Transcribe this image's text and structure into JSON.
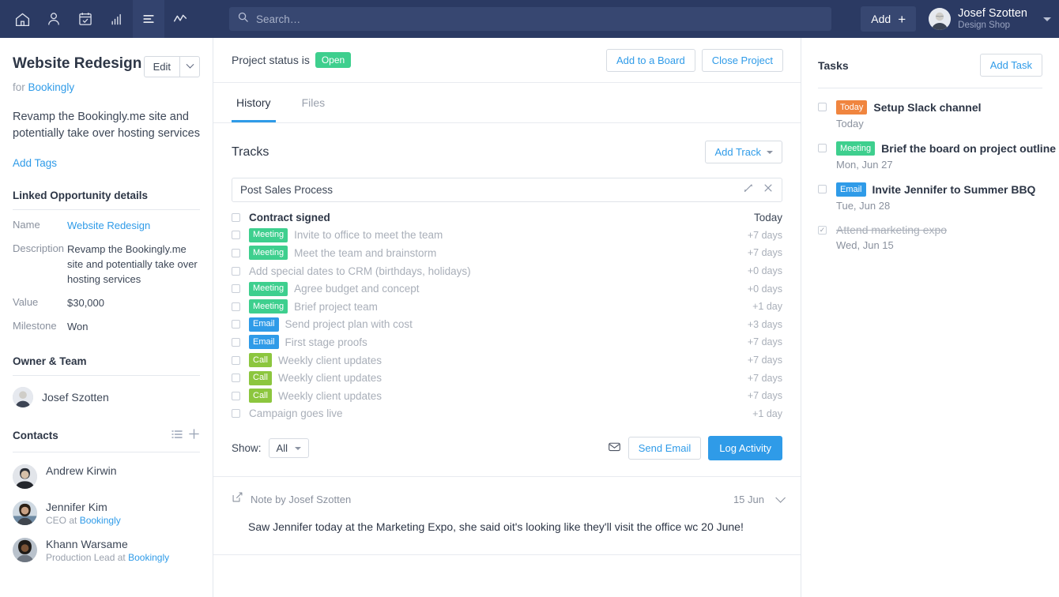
{
  "topnav": {
    "icons": [
      {
        "name": "home-icon",
        "active": false
      },
      {
        "name": "person-icon",
        "active": false
      },
      {
        "name": "calendar-icon",
        "active": false
      },
      {
        "name": "bars-chart-icon",
        "active": false
      },
      {
        "name": "list-lines-icon",
        "active": true
      },
      {
        "name": "activity-line-icon",
        "active": false
      }
    ],
    "search_placeholder": "Search…",
    "add_label": "Add",
    "user_name": "Josef Szotten",
    "user_org": "Design Shop"
  },
  "left": {
    "project_title": "Website Redesign",
    "for_label": "for",
    "company": "Bookingly",
    "edit_label": "Edit",
    "description": "Revamp the Bookingly.me site and potentially take over hosting services",
    "add_tags_label": "Add Tags",
    "opportunity_heading": "Linked Opportunity details",
    "fields": [
      {
        "key": "Name",
        "value": "Website Redesign",
        "link": true
      },
      {
        "key": "Description",
        "value": "Revamp the Bookingly.me site and potentially take over hosting services",
        "link": false
      },
      {
        "key": "Value",
        "value": "$30,000",
        "link": false
      },
      {
        "key": "Milestone",
        "value": "Won",
        "link": false
      }
    ],
    "owner_heading": "Owner & Team",
    "owner_name": "Josef Szotten",
    "contacts_heading": "Contacts",
    "contacts": [
      {
        "name": "Andrew Kirwin",
        "role": "",
        "company": ""
      },
      {
        "name": "Jennifer Kim",
        "role": "CEO at",
        "company": "Bookingly"
      },
      {
        "name": "Khann Warsame",
        "role": "Production Lead at",
        "company": "Bookingly"
      }
    ]
  },
  "center": {
    "status_prefix": "Project status is",
    "status_value": "Open",
    "add_to_board_label": "Add to a Board",
    "close_project_label": "Close Project",
    "tabs": [
      {
        "label": "History",
        "active": true
      },
      {
        "label": "Files",
        "active": false
      }
    ],
    "tracks_title": "Tracks",
    "add_track_label": "Add Track",
    "track_name": "Post Sales Process",
    "track_items": [
      {
        "tag": "",
        "tag_type": "",
        "label": "Contract signed",
        "when": "Today",
        "first": true
      },
      {
        "tag": "Meeting",
        "tag_type": "meeting",
        "label": "Invite to office to meet the team",
        "when": "+7 days",
        "first": false
      },
      {
        "tag": "Meeting",
        "tag_type": "meeting",
        "label": "Meet the team and brainstorm",
        "when": "+7 days",
        "first": false
      },
      {
        "tag": "",
        "tag_type": "",
        "label": "Add special dates to CRM (birthdays, holidays)",
        "when": "+0 days",
        "first": false
      },
      {
        "tag": "Meeting",
        "tag_type": "meeting",
        "label": "Agree budget and concept",
        "when": "+0 days",
        "first": false
      },
      {
        "tag": "Meeting",
        "tag_type": "meeting",
        "label": "Brief project team",
        "when": "+1 day",
        "first": false
      },
      {
        "tag": "Email",
        "tag_type": "email",
        "label": "Send project plan with cost",
        "when": "+3 days",
        "first": false
      },
      {
        "tag": "Email",
        "tag_type": "email",
        "label": "First stage proofs",
        "when": "+7 days",
        "first": false
      },
      {
        "tag": "Call",
        "tag_type": "call",
        "label": "Weekly client updates",
        "when": "+7 days",
        "first": false
      },
      {
        "tag": "Call",
        "tag_type": "call",
        "label": "Weekly client updates",
        "when": "+7 days",
        "first": false
      },
      {
        "tag": "Call",
        "tag_type": "call",
        "label": "Weekly client updates",
        "when": "+7 days",
        "first": false
      },
      {
        "tag": "",
        "tag_type": "",
        "label": "Campaign goes live",
        "when": "+1 day",
        "first": false
      }
    ],
    "show_label": "Show:",
    "show_value": "All",
    "send_email_label": "Send Email",
    "log_activity_label": "Log Activity",
    "note_by": "Note by Josef Szotten",
    "note_date": "15 Jun",
    "note_body": "Saw Jennifer today at the Marketing Expo, she said oit's looking like they'll visit the office wc 20 June!"
  },
  "right": {
    "tasks_title": "Tasks",
    "add_task_label": "Add Task",
    "tasks": [
      {
        "tag": "Today",
        "tag_type": "today",
        "title": "Setup Slack channel",
        "date": "Today",
        "done": false
      },
      {
        "tag": "Meeting",
        "tag_type": "meeting",
        "title": "Brief the board on project outline",
        "date": "Mon, Jun 27",
        "done": false
      },
      {
        "tag": "Email",
        "tag_type": "email",
        "title": "Invite Jennifer to Summer BBQ",
        "date": "Tue, Jun 28",
        "done": false
      },
      {
        "tag": "",
        "tag_type": "",
        "title": "Attend marketing expo",
        "date": "Wed, Jun 15",
        "done": true
      }
    ]
  },
  "colors": {
    "nav_bg": "#2b3a63",
    "accent_blue": "#2f9be8",
    "green": "#3ecf8e",
    "lime": "#8cc63e",
    "orange": "#f0853f"
  }
}
